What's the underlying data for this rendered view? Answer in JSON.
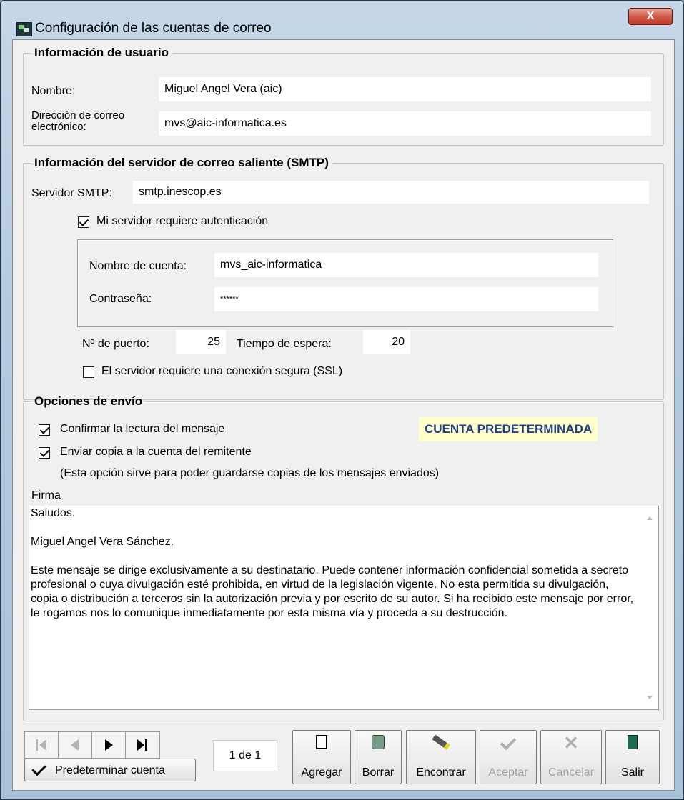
{
  "window": {
    "title": "Configuración de las cuentas de correo",
    "close_label": "X"
  },
  "user_info": {
    "legend": "Información de usuario",
    "name_label": "Nombre:",
    "name_value": "Miguel Angel Vera (aic)",
    "email_label": "Dirección de correo electrónico:",
    "email_value": "mvs@aic-informatica.es"
  },
  "smtp": {
    "legend": "Información del servidor de correo saliente (SMTP)",
    "server_label": "Servidor SMTP:",
    "server_value": "smtp.inescop.es",
    "auth_label": "Mi servidor requiere autenticación",
    "auth_checked": true,
    "account_label": "Nombre de cuenta:",
    "account_value": "mvs_aic-informatica",
    "password_label": "Contraseña:",
    "password_value": "******",
    "port_label": "Nº de puerto:",
    "port_value": "25",
    "timeout_label": "Tiempo de espera:",
    "timeout_value": "20",
    "ssl_label": "El servidor requiere una conexión segura (SSL)",
    "ssl_checked": false
  },
  "send_options": {
    "legend": "Opciones de envío",
    "confirm_label": "Confirmar la lectura del mensaje",
    "confirm_checked": true,
    "copy_label": "Enviar copia a la cuenta del remitente",
    "copy_checked": true,
    "copy_note": "(Esta opción sirve para poder guardarse copias de los mensajes enviados)",
    "default_badge": "CUENTA PREDETERMINADA",
    "signature_label": "Firma",
    "signature_lines": [
      "Saludos.",
      "Miguel Angel Vera Sánchez.",
      "Este mensaje se dirige exclusivamente a su destinatario. Puede contener información confidencial sometida a secreto profesional o cuya divulgación esté prohibida, en virtud de la legislación vigente. No esta permitida su divulgación, copia o distribución a terceros sin la autorización previa y por escrito de su autor. Si ha recibido este mensaje por error, le rogamos nos lo comunique inmediatamente por esta misma vía y proceda a su destrucción."
    ]
  },
  "toolbar": {
    "make_default_label": "Predeterminar cuenta",
    "record_counter": "1 de 1",
    "add_label": "Agregar",
    "delete_label": "Borrar",
    "find_label": "Encontrar",
    "accept_label": "Aceptar",
    "cancel_label": "Cancelar",
    "exit_label": "Salir"
  }
}
